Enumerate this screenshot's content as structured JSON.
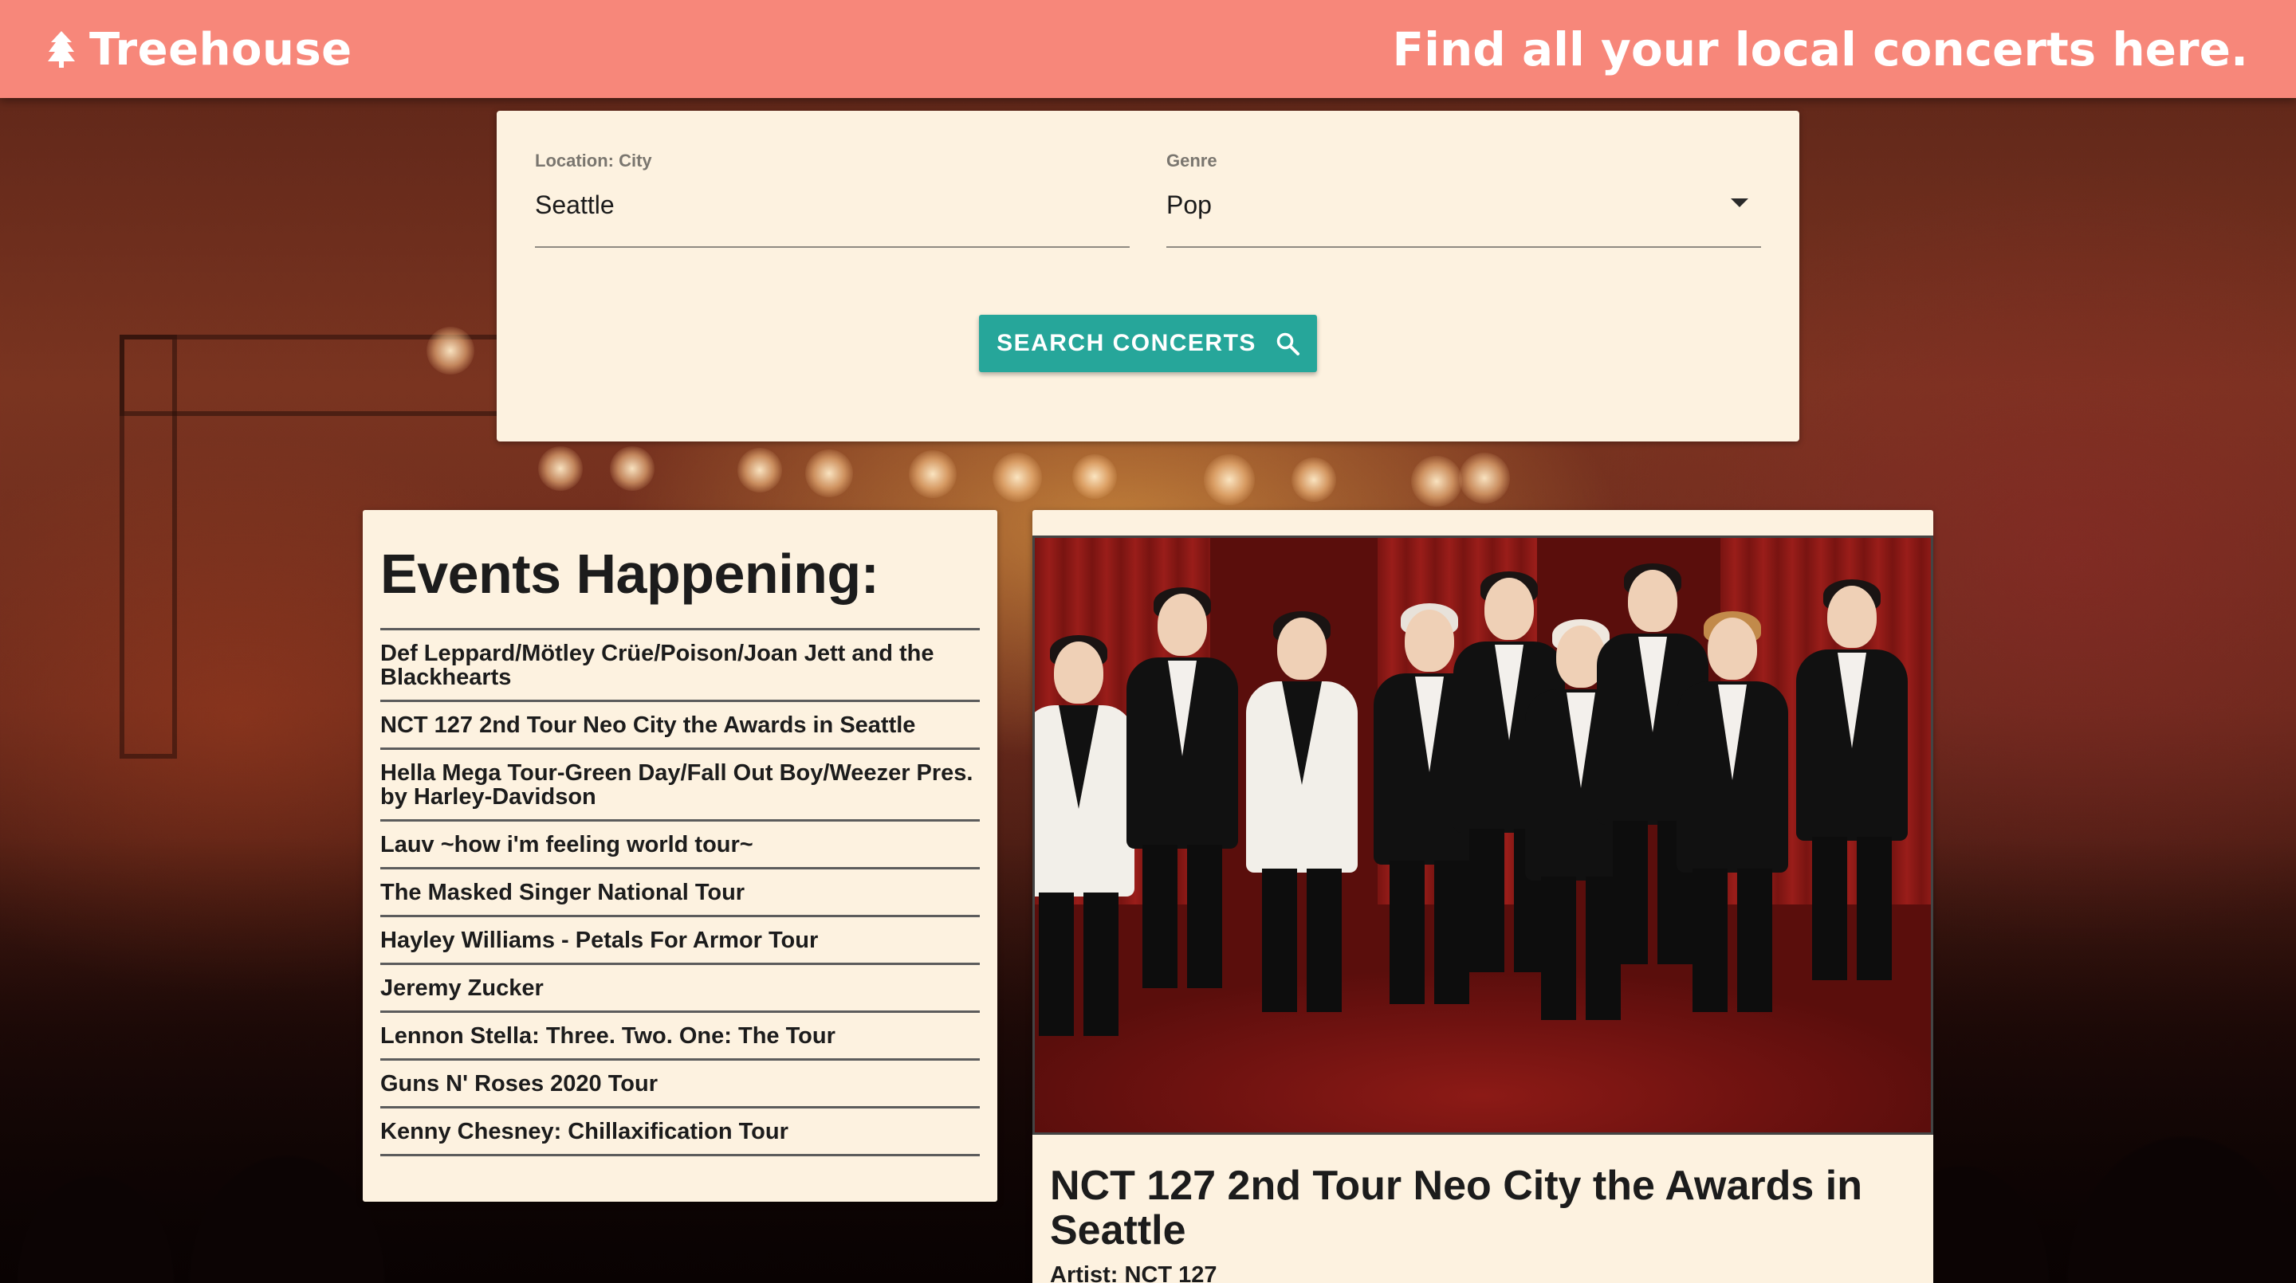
{
  "header": {
    "brand": "Treehouse",
    "tagline": "Find all your local concerts here."
  },
  "search": {
    "city_label": "Location: City",
    "city_value": "Seattle",
    "genre_label": "Genre",
    "genre_value": "Pop",
    "button_label": "SEARCH CONCERTS"
  },
  "events": {
    "title": "Events Happening:",
    "items": [
      "Def Leppard/Mötley Crüe/Poison/Joan Jett and the Blackhearts",
      "NCT 127 2nd Tour Neo City the Awards in Seattle",
      "Hella Mega Tour-Green Day/Fall Out Boy/Weezer Pres. by Harley-Davidson",
      "Lauv ~how i'm feeling world tour~",
      "The Masked Singer National Tour",
      "Hayley Williams - Petals For Armor Tour",
      "Jeremy Zucker",
      "Lennon Stella: Three. Two. One: The Tour",
      "Guns N' Roses 2020 Tour",
      "Kenny Chesney: Chillaxification Tour"
    ]
  },
  "detail": {
    "title": "NCT 127 2nd Tour Neo City the Awards in Seattle",
    "artist": "Artist: NCT 127"
  },
  "colors": {
    "header": "#f7877a",
    "card": "#fdf2e0",
    "accent": "#26a69a"
  },
  "icons": {
    "brand": "tree-icon",
    "search": "search-icon",
    "dropdown": "caret-down-icon"
  }
}
